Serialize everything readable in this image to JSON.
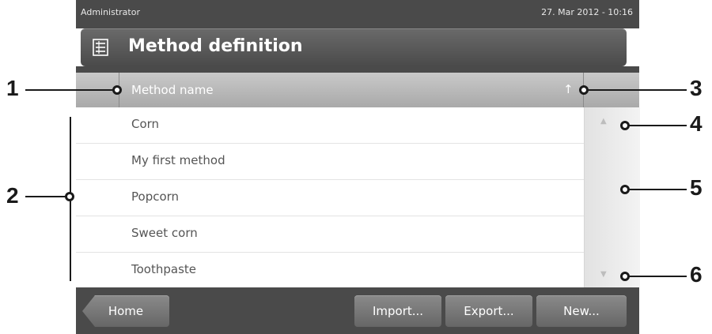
{
  "status": {
    "user": "Administrator",
    "datetime": "27. Mar 2012 - 10:16"
  },
  "header": {
    "title": "Method definition",
    "icon": "method-list-icon"
  },
  "table": {
    "column": "Method name",
    "sort_icon": "↑",
    "rows": [
      "Corn",
      "My first method",
      "Popcorn",
      "Sweet corn",
      "Toothpaste"
    ]
  },
  "scrollbar": {
    "up": "▲",
    "down": "▼"
  },
  "footer": {
    "home": "Home",
    "import": "Import...",
    "export": "Export...",
    "new": "New..."
  },
  "callouts": [
    "1",
    "2",
    "3",
    "4",
    "5",
    "6"
  ]
}
